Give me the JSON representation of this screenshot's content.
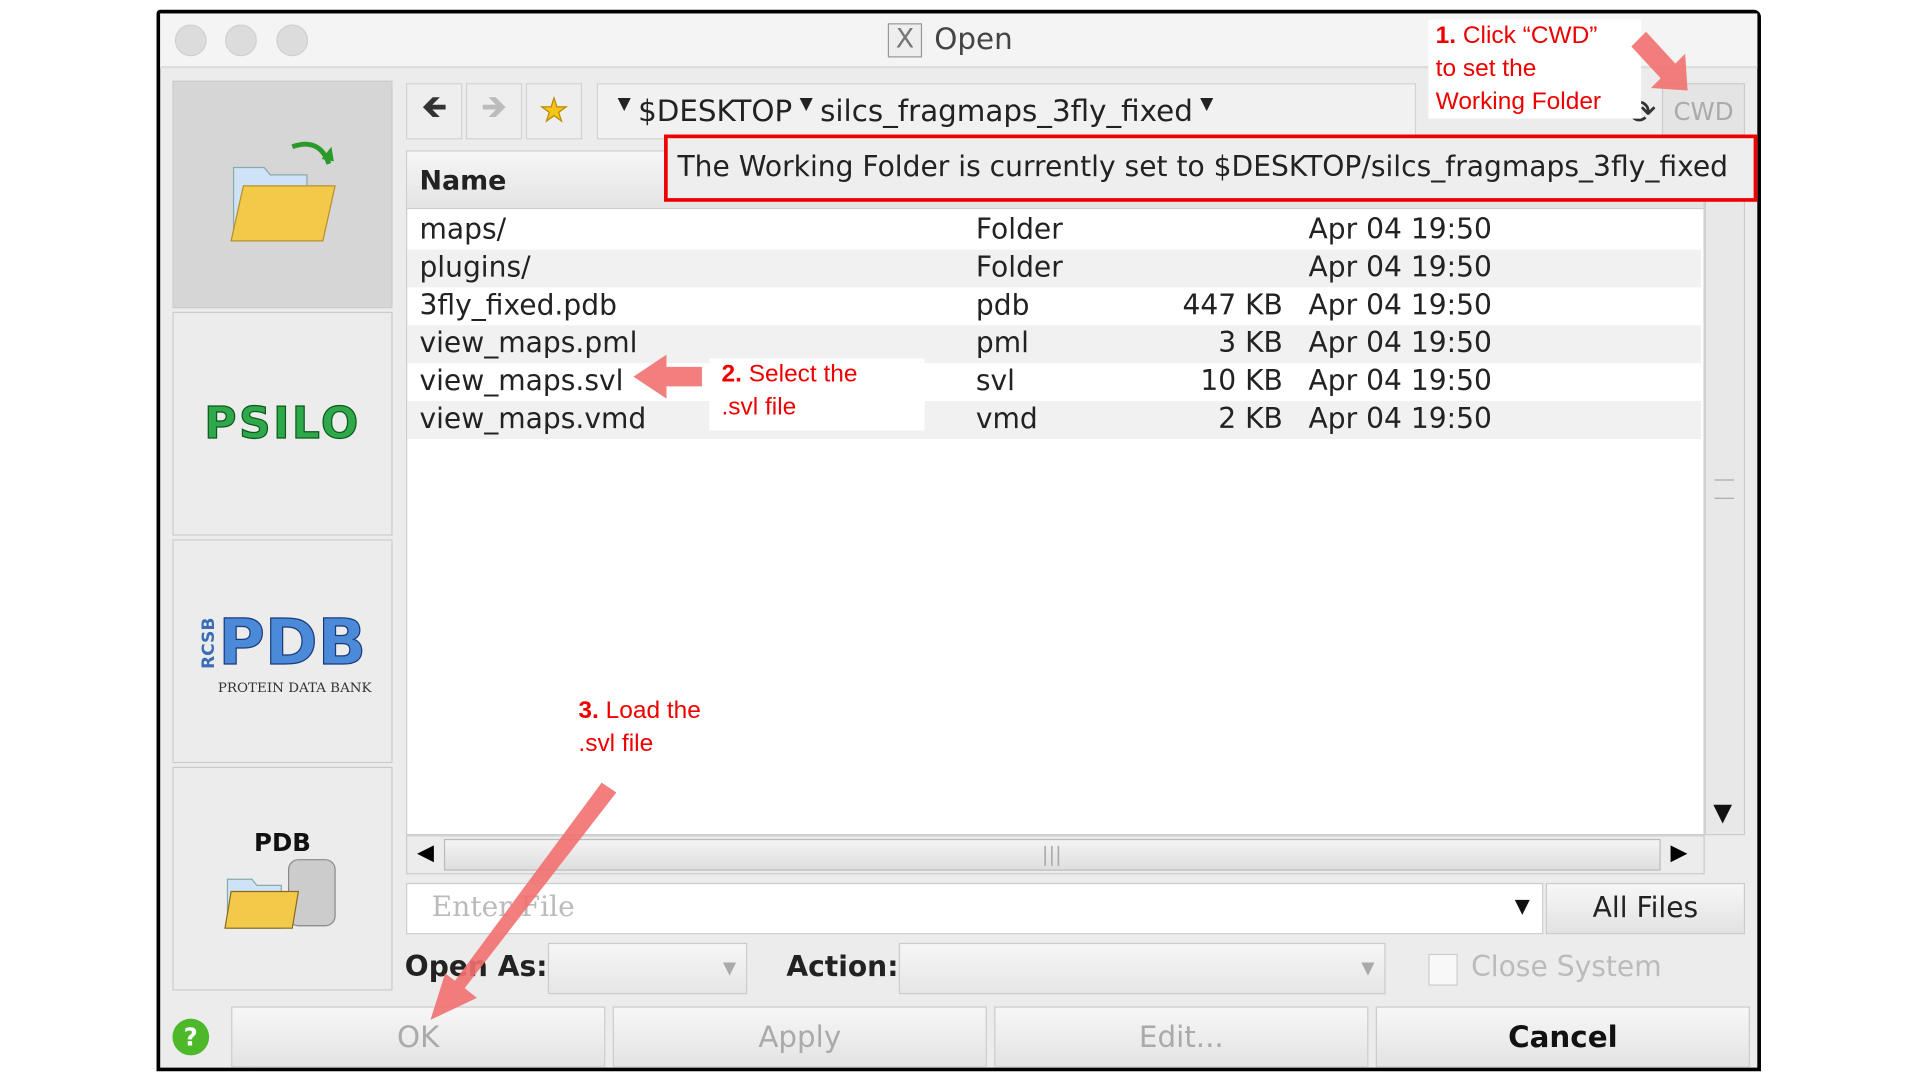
{
  "window": {
    "title": "Open",
    "title_icon": "x11-icon"
  },
  "sidebar": {
    "items": [
      {
        "name": "local-files",
        "icon": "folder-open-icon",
        "selected": true
      },
      {
        "name": "psilo",
        "label": "PSILO"
      },
      {
        "name": "rcsb-pdb",
        "label": "PDB",
        "sublabel": "PROTEIN DATA BANK",
        "side": "RCSB"
      },
      {
        "name": "pdb-database",
        "label": "PDB"
      }
    ]
  },
  "toolbar": {
    "back": "arrow-left-icon",
    "forward": "arrow-right-icon",
    "favorite": "star-icon",
    "path": [
      "$DESKTOP",
      "silcs_fragmaps_3fly_fixed"
    ],
    "cwd_label": "CWD",
    "refresh": "refresh-icon"
  },
  "table": {
    "header": "Name",
    "rows": [
      {
        "name": "maps/",
        "type": "Folder",
        "size": "",
        "date": "Apr 04 19:50"
      },
      {
        "name": "plugins/",
        "type": "Folder",
        "size": "",
        "date": "Apr 04 19:50"
      },
      {
        "name": "3fly_fixed.pdb",
        "type": "pdb",
        "size": "447 KB",
        "date": "Apr 04 19:50"
      },
      {
        "name": "view_maps.pml",
        "type": "pml",
        "size": "3 KB",
        "date": "Apr 04 19:50"
      },
      {
        "name": "view_maps.svl",
        "type": "svl",
        "size": "10 KB",
        "date": "Apr 04 19:50"
      },
      {
        "name": "view_maps.vmd",
        "type": "vmd",
        "size": "2 KB",
        "date": "Apr 04 19:50"
      }
    ]
  },
  "tooltip": "The Working Folder is currently set  to  $DESKTOP/silcs_fragmaps_3fly_fixed",
  "file_input": {
    "placeholder": "Enter File",
    "filter": "All Files"
  },
  "options": {
    "open_as_label": "Open As:",
    "action_label": "Action:",
    "close_system_label": "Close System",
    "close_system_checked": false
  },
  "buttons": {
    "ok": "OK",
    "apply": "Apply",
    "edit": "Edit...",
    "cancel": "Cancel",
    "help": "help-icon"
  },
  "annotations": {
    "step1_num": "1.",
    "step1": "Click “CWD”",
    "step1b": "to set the",
    "step1c": "Working Folder",
    "step2_num": "2.",
    "step2": "Select the",
    "step2b": ".svl file",
    "step3_num": "3.",
    "step3": "Load the",
    "step3b": ".svl file"
  },
  "colors": {
    "annotation": "#e00000",
    "arrow": "#f27070"
  }
}
